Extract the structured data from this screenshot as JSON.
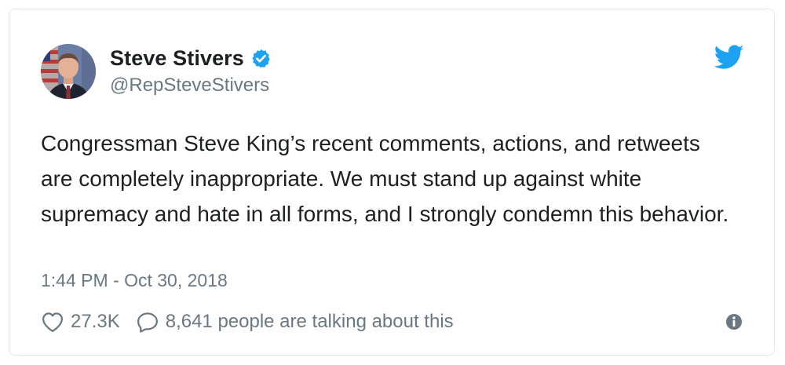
{
  "author": {
    "display_name": "Steve Stivers",
    "handle": "@RepSteveStivers",
    "verified": true,
    "avatar_icon": "profile-photo"
  },
  "tweet": {
    "text": "Congressman Steve King’s recent comments, actions, and retweets are completely inappropriate. We must stand up against white supremacy and hate in all forms, and I strongly condemn this behavior.",
    "timestamp": "1:44 PM - Oct 30, 2018"
  },
  "actions": {
    "likes": "27.3K",
    "conversation": "8,641 people are talking about this"
  },
  "icons": {
    "brand": "twitter-bird-icon",
    "verified": "verified-badge-icon",
    "like": "heart-icon",
    "reply": "speech-bubble-icon",
    "info": "info-icon"
  },
  "colors": {
    "brand_blue": "#1da1f2",
    "text_primary": "#1c2022",
    "text_secondary": "#697882",
    "border": "#e1e8ed"
  }
}
